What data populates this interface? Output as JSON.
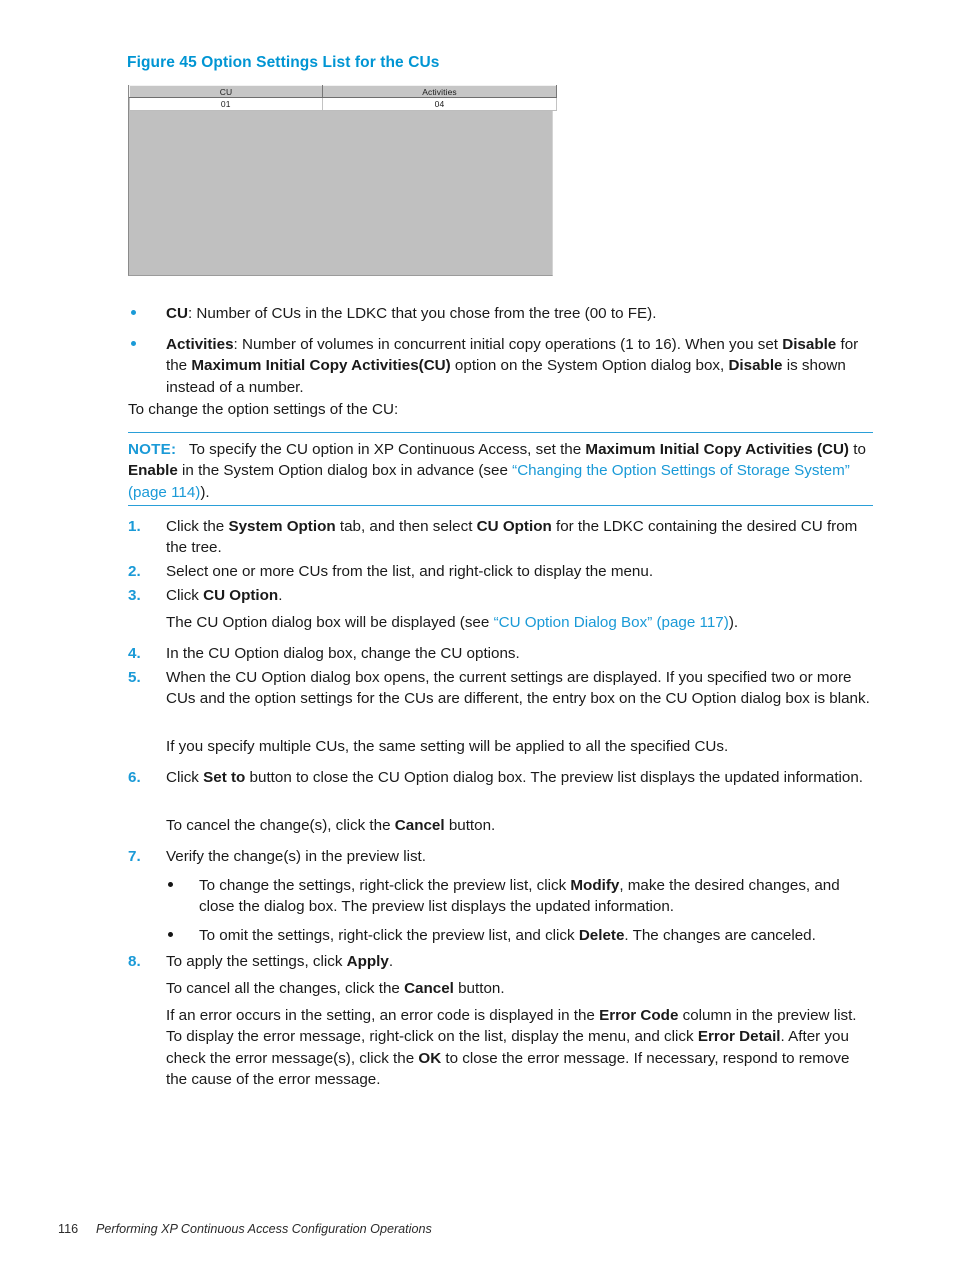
{
  "figure": {
    "caption": "Figure 45 Option Settings List for the CUs",
    "table": {
      "headers": [
        "CU",
        "Activities"
      ],
      "rows": [
        [
          "01",
          "04"
        ]
      ]
    }
  },
  "bullets": [
    {
      "term": "CU",
      "rest": ": Number of CUs in the LDKC that you chose from the tree (00 to FE)."
    },
    {
      "term": "Activities",
      "rest_1": ": Number of volumes in concurrent initial copy operations (1 to 16). When you set ",
      "bold_1": "Disable",
      "rest_2": " for the ",
      "bold_2": "Maximum Initial Copy Activities(CU)",
      "rest_3": " option on the System Option dialog box, ",
      "bold_3": "Disable",
      "rest_4": " is shown instead of a number."
    }
  ],
  "intro": "To change the option settings of the CU:",
  "note": {
    "label": "NOTE:",
    "text_1": "To specify the CU option in XP Continuous Access, set the ",
    "bold_1": "Maximum Initial Copy Activities (CU)",
    "text_2": " to ",
    "bold_2": "Enable",
    "text_3": " in the System Option dialog box in advance (see ",
    "link": "“Changing the Option Settings of Storage System” (page 114)",
    "text_4": ")."
  },
  "steps": [
    {
      "marker": "1.",
      "text_1": "Click the ",
      "bold_1": "System Option",
      "text_2": " tab, and then select ",
      "bold_2": "CU Option",
      "text_3": " for the LDKC containing the desired CU from the tree."
    },
    {
      "marker": "2.",
      "text_1": "Select one or more CUs from the list, and right-click to display the menu."
    },
    {
      "marker": "3.",
      "text_1": "Click ",
      "bold_1": "CU Option",
      "text_2": ".",
      "cont_1": "The CU Option dialog box will be displayed (see ",
      "cont_link": "“CU Option Dialog Box” (page 117)",
      "cont_2": ")."
    },
    {
      "marker": "4.",
      "text_1": "In the CU Option dialog box, change the CU options."
    },
    {
      "marker": "5.",
      "text_1": "When the CU Option dialog box opens, the current settings are displayed. If you specified two or more CUs and the option settings for the CUs are different, the entry box on the CU Option dialog box is blank.",
      "cont_1": "If you specify multiple CUs, the same setting will be applied to all the specified CUs."
    },
    {
      "marker": "6.",
      "text_1": "Click ",
      "bold_1": "Set to",
      "text_2": " button to close the CU Option dialog box. The preview list displays the updated information.",
      "cont_1": "To cancel the change(s), click the ",
      "cont_bold": "Cancel",
      "cont_2": " button."
    },
    {
      "marker": "7.",
      "text_1": "Verify the change(s) in the preview list."
    },
    {
      "marker": "8.",
      "text_1": "To apply the settings, click ",
      "bold_1": "Apply",
      "text_2": ".",
      "cont_1": "To cancel all the changes, click the ",
      "cont_bold": "Cancel",
      "cont_2": " button."
    }
  ],
  "subbullets": [
    {
      "text_1": "To change the settings, right-click the preview list, click ",
      "bold_1": "Modify",
      "text_2": ", make the desired changes, and close the dialog box. The preview list displays the updated information."
    },
    {
      "text_1": "To omit the settings, right-click the preview list, and click ",
      "bold_1": "Delete",
      "text_2": ". The changes are canceled."
    }
  ],
  "error_paragraph": {
    "text_1": "If an error occurs in the setting, an error code is displayed in the ",
    "bold_1": "Error Code",
    "text_2": " column in the preview list. To display the error message, right-click on the list, display the menu, and click ",
    "bold_2": "Error Detail",
    "text_3": ". After you check the error message(s), click the ",
    "bold_3": "OK",
    "text_4": " to close the error message. If necessary, respond to remove the cause of the error message."
  },
  "footer": {
    "page_number": "116",
    "title": "Performing XP Continuous Access Configuration Operations"
  },
  "colors": {
    "accent_blue": "#0095d3",
    "link_blue": "#1a9ad7",
    "text": "#1a1a1a"
  }
}
